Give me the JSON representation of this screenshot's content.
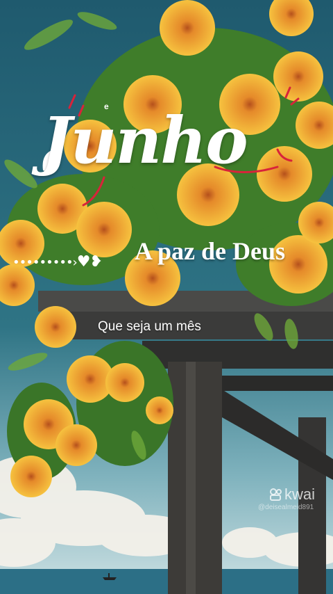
{
  "title_word": "Junho",
  "title_prefix": "e",
  "dots_decoration": "•••••••••›",
  "headline": "A paz de Deus",
  "caption": "Que seja um mês",
  "watermark": {
    "brand": "kwai",
    "handle": "@deisealmeid891"
  },
  "colors": {
    "sky": "#2f6f80",
    "accent_red": "#d8233a",
    "flower": "#f2b233",
    "wood": "#3a3a3a"
  }
}
